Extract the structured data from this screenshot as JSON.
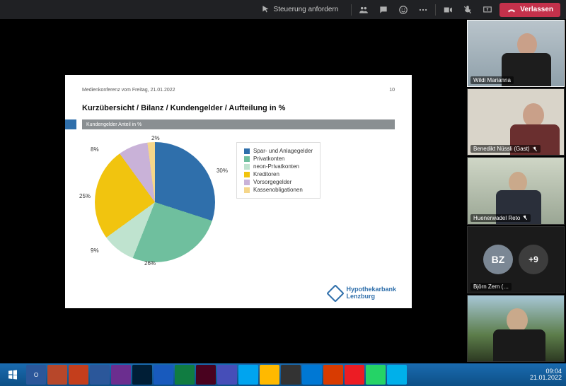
{
  "teams": {
    "request_control": "Steuerung anfordern",
    "leave": "Verlassen"
  },
  "slide": {
    "doc_title": "Medienkonferenz vom Freitag, 21.01.2022",
    "page_no": "10",
    "title": "Kurzübersicht / Bilanz / Kundengelder / Aufteilung in %",
    "subbar": "Kundengelder Anteil in %",
    "brand_line1": "Hypothekarbank",
    "brand_line2": "Lenzburg"
  },
  "chart_data": {
    "type": "pie",
    "title": "Kundengelder Anteil in %",
    "series": [
      {
        "name": "Spar- und Anlagegelder",
        "value": 30,
        "color": "#2f6fab"
      },
      {
        "name": "Privatkonten",
        "value": 26,
        "color": "#6fbf9e"
      },
      {
        "name": "neon-Privatkonten",
        "value": 9,
        "color": "#bfe3cf"
      },
      {
        "name": "Kreditoren",
        "value": 25,
        "color": "#f1c40f"
      },
      {
        "name": "Vorsorgegelder",
        "value": 8,
        "color": "#c9b2d8"
      },
      {
        "name": "Kassenobligationen",
        "value": 2,
        "color": "#f5d68a"
      }
    ],
    "labels": {
      "p30": "30%",
      "p26": "26%",
      "p9": "9%",
      "p25": "25%",
      "p8": "8%",
      "p2": "2%"
    }
  },
  "participants": {
    "p1": "Wildi Marianna",
    "p2": "Benedikt Nüssli (Gast)",
    "p3": "Huenerwadel Reto",
    "p4_initials": "BZ",
    "p4": "Björn Zern (…",
    "overflow": "+9"
  },
  "clock": {
    "time": "09:04",
    "date": "21.01.2022"
  },
  "legend": {
    "l0": "Spar- und Anlagegelder",
    "l1": "Privatkonten",
    "l2": "neon-Privatkonten",
    "l3": "Kreditoren",
    "l4": "Vorsorgegelder",
    "l5": "Kassenobligationen"
  }
}
